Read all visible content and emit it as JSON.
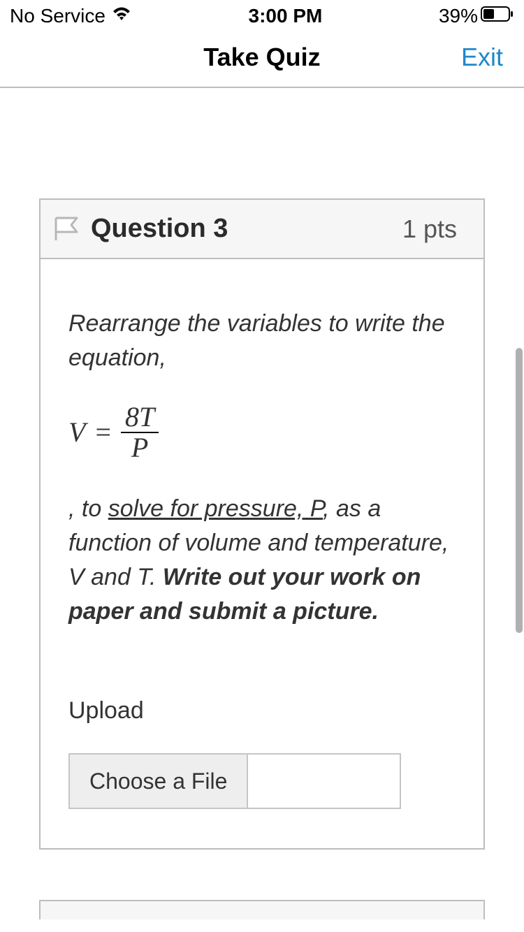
{
  "status_bar": {
    "service": "No Service",
    "time": "3:00 PM",
    "battery": "39%"
  },
  "nav": {
    "title": "Take Quiz",
    "exit": "Exit"
  },
  "question": {
    "label": "Question 3",
    "points": "1 pts",
    "prompt_before": "Rearrange the variables to write the equation,",
    "equation": {
      "lhs": "V",
      "eq": "=",
      "numerator": "8T",
      "denominator": "P"
    },
    "prompt_after_1": ", to ",
    "prompt_underlined": "solve for pressure, P",
    "prompt_after_2": ", as a function of volume and temperature, V and T. ",
    "prompt_bold": "Write out your work on paper and submit a picture.",
    "upload_label": "Upload",
    "choose_file": "Choose a File"
  }
}
